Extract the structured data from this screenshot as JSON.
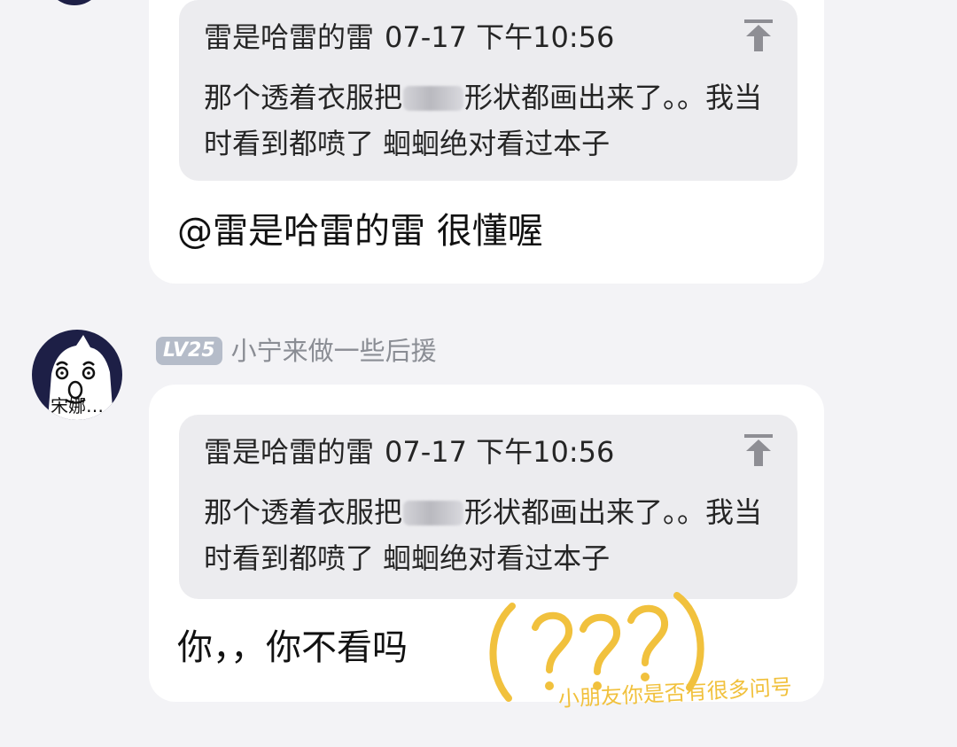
{
  "posts": [
    {
      "quote": {
        "author": "雷是哈雷的雷",
        "time": "07-17 下午10:56",
        "line1_before": "那个透着衣服把",
        "line1_after": "形状都画出来了。。我当",
        "line2": "时看到都喷了 蛔蛔绝对看过本子"
      },
      "reply": "@雷是哈雷的雷 很懂喔"
    },
    {
      "user": {
        "level": "LV25",
        "name": "小宁来做一些后援",
        "avatar_caption": "宋娜…"
      },
      "quote": {
        "author": "雷是哈雷的雷",
        "time": "07-17 下午10:56",
        "line1_before": "那个透着衣服把",
        "line1_after": "形状都画出来了。。我当",
        "line2": "时看到都喷了 蛔蛔绝对看过本子"
      },
      "reply": "你，，你不看吗"
    }
  ],
  "annotation": {
    "mark": "(???)",
    "caption": "小朋友你是否有很多问号",
    "color": "#f1c13d"
  },
  "colors": {
    "background": "#f3f3f6",
    "card": "#ffffff",
    "quote": "#ececef",
    "badge": "#b5bcc9",
    "username": "#8a8d94",
    "avatar_dark": "#1d1f46"
  },
  "icons": {
    "pin": "pin-to-top-icon",
    "blur": "blurred-mask"
  }
}
